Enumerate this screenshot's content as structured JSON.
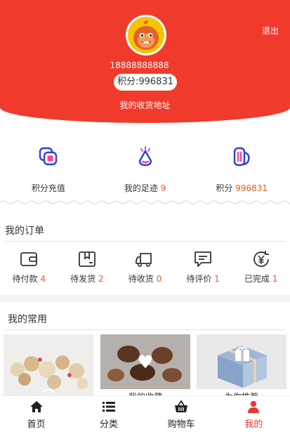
{
  "header": {
    "logout_label": "退出",
    "phone": "18888888888",
    "points_label": "积分:996831",
    "address_label": "我的收货地址"
  },
  "quick": [
    {
      "label": "积分充值",
      "count": ""
    },
    {
      "label": "我的足迹",
      "count": "9"
    },
    {
      "label": "积分",
      "count": "996831"
    }
  ],
  "orders": {
    "title": "我的订单",
    "items": [
      {
        "label": "待付款",
        "count": "4"
      },
      {
        "label": "待发货",
        "count": "2"
      },
      {
        "label": "待收货",
        "count": "0"
      },
      {
        "label": "待评价",
        "count": "1"
      },
      {
        "label": "已完成",
        "count": "1"
      }
    ]
  },
  "common": {
    "title": "我的常用",
    "tiles": [
      {
        "label": ""
      },
      {
        "label": "我的收藏"
      },
      {
        "label": "为你推荐"
      }
    ]
  },
  "tabbar": [
    {
      "label": "首页"
    },
    {
      "label": "分类"
    },
    {
      "label": "购物车"
    },
    {
      "label": "我的"
    }
  ],
  "colors": {
    "header": "#f03a2c",
    "accent": "#e85a2a",
    "active_tab": "#e53935",
    "icon_blue": "#2f3fd0",
    "icon_pink": "#ff3fa4"
  }
}
